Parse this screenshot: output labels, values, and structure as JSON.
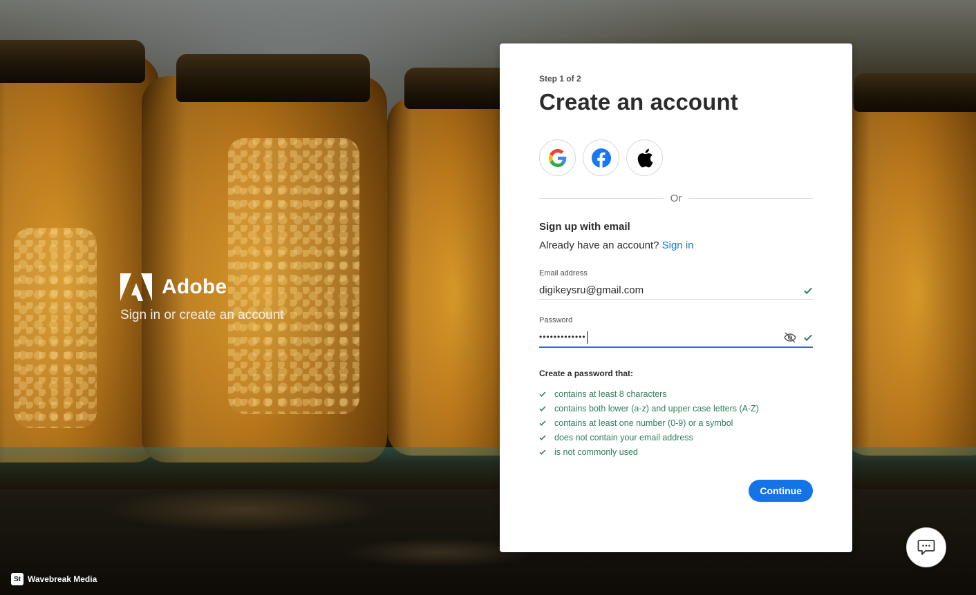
{
  "brand": {
    "name": "Adobe",
    "tagline": "Sign in or create an account",
    "logo_icon": "adobe-logo-icon",
    "color": "#ffffff"
  },
  "credit": {
    "badge": "St",
    "text": "Wavebreak Media"
  },
  "card": {
    "step": "Step 1 of 2",
    "title": "Create an account",
    "social": [
      {
        "name": "google",
        "icon": "google-icon"
      },
      {
        "name": "facebook",
        "icon": "facebook-icon"
      },
      {
        "name": "apple",
        "icon": "apple-icon"
      }
    ],
    "divider_text": "Or",
    "signup_heading": "Sign up with email",
    "already_text": "Already have an account?",
    "signin_link": "Sign in",
    "email": {
      "label": "Email address",
      "value": "digikeysru@gmail.com",
      "valid": true
    },
    "password": {
      "label": "Password",
      "value": "•••••••••••••",
      "valid": true,
      "focused": true
    },
    "requirements_heading": "Create a password that:",
    "requirements": [
      "contains at least 8 characters",
      "contains both lower (a-z) and upper case letters (A-Z)",
      "contains at least one number (0-9) or a symbol",
      "does not contain your email address",
      "is not commonly used"
    ],
    "continue_label": "Continue"
  },
  "colors": {
    "accent": "#1473e6",
    "success": "#2d7d5a",
    "text": "#2c2c2c"
  },
  "chat": {
    "icon": "chat-bubble-icon"
  }
}
